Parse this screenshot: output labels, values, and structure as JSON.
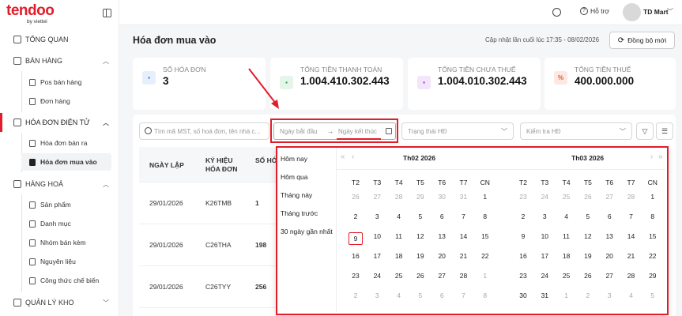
{
  "brand": {
    "name": "tendoo",
    "sub": "by viettel"
  },
  "sidebar": {
    "tong_quan": "TỔNG QUAN",
    "ban_hang": "BÁN HÀNG",
    "pos": "Pos bán hàng",
    "don_hang": "Đơn hàng",
    "hoa_don": "HÓA ĐƠN ĐIỆN TỬ",
    "hd_ban_ra": "Hóa đơn bán ra",
    "hd_mua_vao": "Hóa đơn mua vào",
    "hang_hoa": "HÀNG HOÁ",
    "san_pham": "Sản phẩm",
    "danh_muc": "Danh mục",
    "nhom_ban_kem": "Nhóm bán kèm",
    "nguyen_lieu": "Nguyên liệu",
    "cong_thuc": "Công thức chế biến",
    "quan_ly_kho": "QUẢN LÝ KHO"
  },
  "topbar": {
    "help": "Hỗ trợ",
    "user": "TD Mart"
  },
  "page": {
    "title": "Hóa đơn mua vào",
    "updated": "Cập nhật lần cuối lúc 17:35 - 08/02/2026",
    "sync": "Đồng bộ mới"
  },
  "cards": [
    {
      "title": "SỐ HÓA ĐƠN",
      "value": "3",
      "color": "#1e6fd9"
    },
    {
      "title": "TỔNG TIỀN THANH TOÁN",
      "value": "1.004.410.302.443",
      "color": "#2a9d4a"
    },
    {
      "title": "TỔNG TIỀN CHƯA THUẾ",
      "value": "1.004.010.302.443",
      "color": "#9b30d9"
    },
    {
      "title": "TỔNG TIỀN THUẾ",
      "value": "400.000.000",
      "color": "#e8572a"
    }
  ],
  "filters": {
    "search_placeholder": "Tìm mã MST, số hoá đơn, tên nhà c...",
    "start_placeholder": "Ngày bắt đầu",
    "end_placeholder": "Ngày kết thúc",
    "status_placeholder": "Trạng thái HĐ",
    "check_placeholder": "Kiểm tra HĐ"
  },
  "table": {
    "headers": [
      "NGÀY LẬP",
      "KÝ HIỆU HÓA ĐƠN",
      "SỐ HÓ ĐƠN"
    ],
    "rows": [
      [
        "29/01/2026",
        "K26TMB",
        "1"
      ],
      [
        "29/01/2026",
        "C26THA",
        "198"
      ],
      [
        "29/01/2026",
        "C26TYY",
        "256"
      ]
    ]
  },
  "picker": {
    "presets": [
      "Hôm nay",
      "Hôm qua",
      "Tháng này",
      "Tháng trước",
      "30 ngày gần nhất"
    ],
    "weekdays": [
      "T2",
      "T3",
      "T4",
      "T5",
      "T6",
      "T7",
      "CN"
    ],
    "left": {
      "title": "Th02  2026",
      "weeks": [
        [
          "26",
          "27",
          "28",
          "29",
          "30",
          "31",
          "1"
        ],
        [
          "2",
          "3",
          "4",
          "5",
          "6",
          "7",
          "8"
        ],
        [
          "9",
          "10",
          "11",
          "12",
          "13",
          "14",
          "15"
        ],
        [
          "16",
          "17",
          "18",
          "19",
          "20",
          "21",
          "22"
        ],
        [
          "23",
          "24",
          "25",
          "26",
          "27",
          "28",
          "1"
        ],
        [
          "2",
          "3",
          "4",
          "5",
          "6",
          "7",
          "8"
        ]
      ]
    },
    "right": {
      "title": "Th03  2026",
      "weeks": [
        [
          "23",
          "24",
          "25",
          "26",
          "27",
          "28",
          "1"
        ],
        [
          "2",
          "3",
          "4",
          "5",
          "6",
          "7",
          "8"
        ],
        [
          "9",
          "10",
          "11",
          "12",
          "13",
          "14",
          "15"
        ],
        [
          "16",
          "17",
          "18",
          "19",
          "20",
          "21",
          "22"
        ],
        [
          "23",
          "24",
          "25",
          "26",
          "27",
          "28",
          "29"
        ],
        [
          "30",
          "31",
          "1",
          "2",
          "3",
          "4",
          "5"
        ]
      ]
    }
  }
}
